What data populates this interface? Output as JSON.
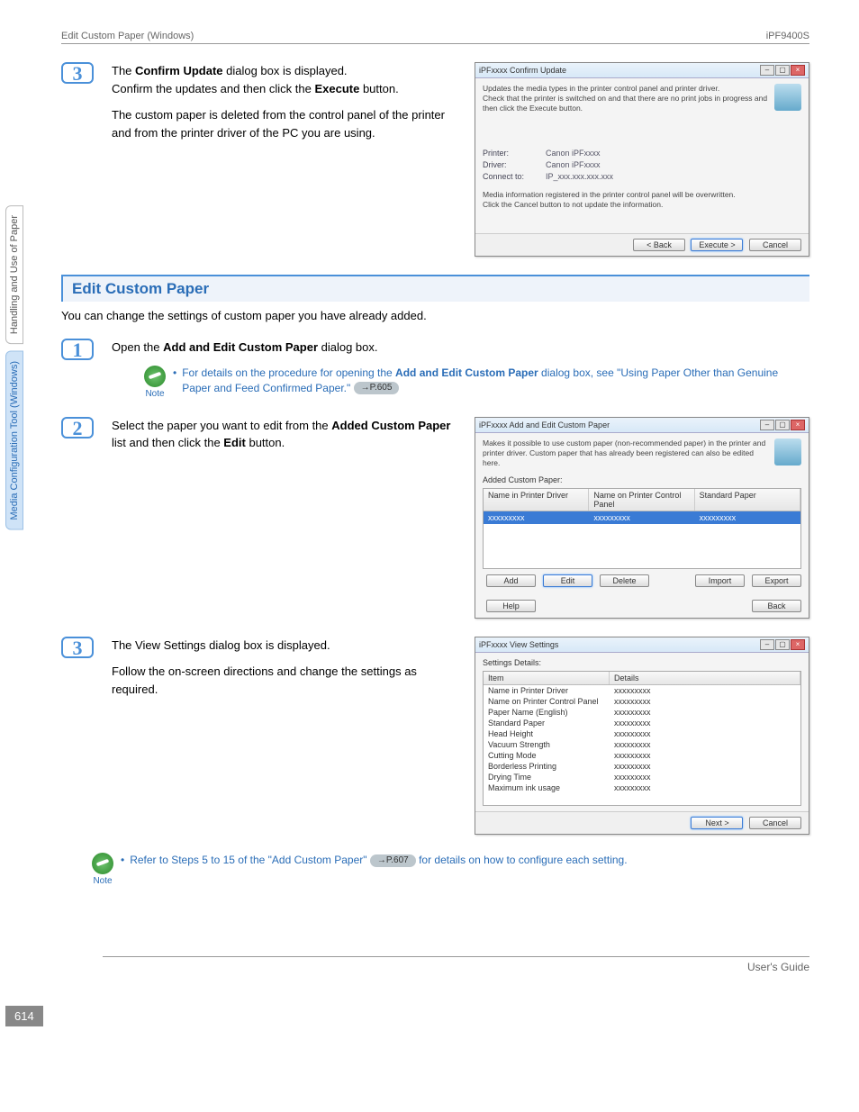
{
  "header": {
    "left": "Edit Custom Paper (Windows)",
    "right": "iPF9400S"
  },
  "side_tabs": {
    "tab1": "Handling and Use of Paper",
    "tab2": "Media Configuration Tool (Windows)"
  },
  "prev_step3": {
    "num": "3",
    "p1a": "The ",
    "p1b": "Confirm Update",
    "p1c": " dialog box is displayed.",
    "p2a": "Confirm the updates and then click the ",
    "p2b": "Execute",
    "p2c": " button.",
    "p3": "The custom paper is deleted from the control panel of the printer and from the printer driver of the PC you are using."
  },
  "confirm_dialog": {
    "title": "iPFxxxx Confirm Update",
    "desc": "Updates the media types in the printer control panel and printer driver.\nCheck that the printer is switched on and that there are no print jobs in progress and then click the Execute button.",
    "rows": {
      "printer_lbl": "Printer:",
      "printer_val": "Canon iPFxxxx",
      "driver_lbl": "Driver:",
      "driver_val": "Canon iPFxxxx",
      "connect_lbl": "Connect to:",
      "connect_val": "IP_xxx.xxx.xxx.xxx"
    },
    "warn": "Media information registered in the printer control panel will be overwritten.\nClick the Cancel button to not update the information.",
    "btn_back": "< Back",
    "btn_exec": "Execute >",
    "btn_cancel": "Cancel"
  },
  "section": {
    "title": "Edit Custom Paper",
    "intro": "You can change the settings of custom paper you have already added."
  },
  "step1": {
    "num": "1",
    "text_a": "Open the ",
    "text_b": "Add and Edit Custom Paper",
    "text_c": " dialog box.",
    "note_label": "Note",
    "note_a": "For details on the procedure for opening the ",
    "note_b": "Add and Edit Custom Paper",
    "note_c": " dialog box, see \"Using Paper Other than Genuine Paper and Feed Confirmed Paper.\" ",
    "note_ref": "→P.605"
  },
  "step2": {
    "num": "2",
    "text_a": "Select the paper you want to edit from the ",
    "text_b": "Added Custom Paper",
    "text_c": " list and then click the ",
    "text_d": "Edit",
    "text_e": " button."
  },
  "addedit_dialog": {
    "title": "iPFxxxx Add and Edit Custom Paper",
    "desc": "Makes it possible to use custom paper (non-recommended paper) in the printer and printer driver. Custom paper that has already been registered can also be edited here.",
    "list_label": "Added Custom Paper:",
    "col1": "Name in Printer Driver",
    "col2": "Name on Printer Control Panel",
    "col3": "Standard Paper",
    "cellval": "xxxxxxxxx",
    "btn_add": "Add",
    "btn_edit": "Edit",
    "btn_delete": "Delete",
    "btn_import": "Import",
    "btn_export": "Export",
    "btn_help": "Help",
    "btn_back": "Back"
  },
  "step3": {
    "num": "3",
    "p1": "The View Settings dialog box is displayed.",
    "p2": "Follow the on-screen directions and change the settings as required."
  },
  "view_dialog": {
    "title": "iPFxxxx View Settings",
    "heading": "Settings Details:",
    "col1": "Item",
    "col2": "Details",
    "items": [
      "Name in Printer Driver",
      "Name on Printer Control Panel",
      "Paper Name (English)",
      "Standard Paper",
      "Head Height",
      "Vacuum Strength",
      "Cutting Mode",
      "Borderless Printing",
      "Drying Time",
      "Maximum ink usage"
    ],
    "val": "xxxxxxxxx",
    "btn_next": "Next >",
    "btn_cancel": "Cancel"
  },
  "note2": {
    "label": "Note",
    "text_a": "Refer to Steps 5 to 15 of the \"Add Custom Paper\" ",
    "ref": "→P.607",
    "text_b": "  for details on how to configure each setting."
  },
  "page_number": "614",
  "footer_right": "User's Guide"
}
